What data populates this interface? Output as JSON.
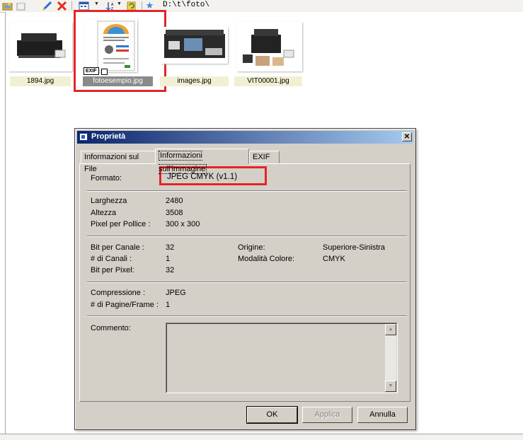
{
  "toolbar": {
    "path": "D:\\t\\foto\\",
    "icons": [
      "open-folder-icon",
      "new-folder-icon",
      "edit-icon",
      "delete-icon",
      "view-mode-icon",
      "sort-icon",
      "refresh-icon",
      "favorites-icon"
    ]
  },
  "thumbnails": [
    {
      "name": "1894.jpg",
      "selected": false
    },
    {
      "name": "fotoesempio.jpg",
      "selected": true,
      "badge": "EXIF"
    },
    {
      "name": "images.jpg",
      "selected": false
    },
    {
      "name": "VIT00001.jpg",
      "selected": false
    }
  ],
  "dialog": {
    "title": "Proprietà",
    "close_glyph": "✕",
    "tabs": [
      "Informazioni sul File",
      "Informazioni sull'immagine",
      "EXIF"
    ],
    "active_tab": 1,
    "format": {
      "label": "Formato:",
      "value": "JPEG CMYK (v1.1)"
    },
    "dimensions": [
      {
        "label": "Larghezza",
        "value": "2480"
      },
      {
        "label": "Altezza",
        "value": "3508"
      },
      {
        "label": "Pixel per Pollice :",
        "value": "300 x 300"
      }
    ],
    "channels_left": [
      {
        "label": "Bit per Canale :",
        "value": "32"
      },
      {
        "label": "# di Canali :",
        "value": "1"
      },
      {
        "label": "Bit per Pixel:",
        "value": "32"
      }
    ],
    "channels_right": [
      {
        "label": "Origine:",
        "value": "Superiore-Sinistra"
      },
      {
        "label": "Modalità Colore:",
        "value": "CMYK"
      }
    ],
    "compression": [
      {
        "label": "Compressione :",
        "value": "JPEG"
      },
      {
        "label": "# di Pagine/Frame :",
        "value": "1"
      }
    ],
    "comment": {
      "label": "Commento:",
      "value": ""
    },
    "buttons": {
      "ok": "OK",
      "apply": "Applica",
      "cancel": "Annulla"
    }
  }
}
